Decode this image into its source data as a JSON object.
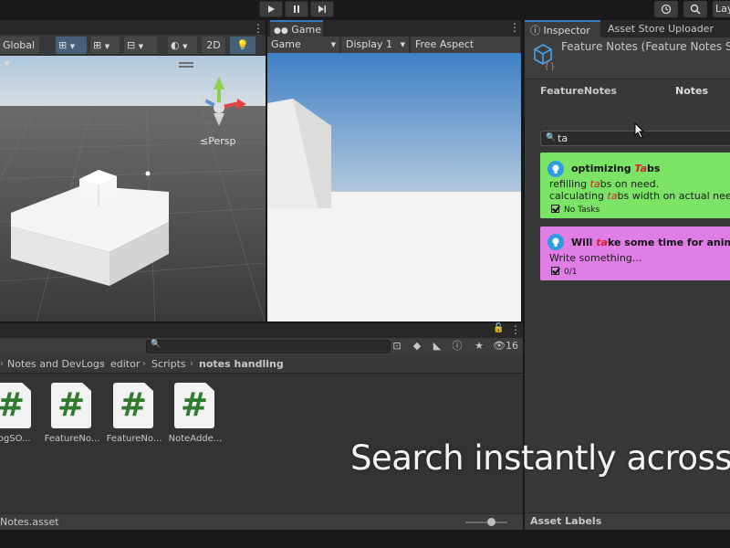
{
  "toolbar": {
    "play_icon": "▶",
    "pause_icon": "❚❚",
    "step_icon": "▶|",
    "history_icon": "history-icon",
    "search_icon": "search-icon",
    "layout_label": "Lay"
  },
  "scene": {
    "pivot_label": "Global",
    "mode_2d_label": "2D",
    "persp_label": "Persp"
  },
  "game": {
    "tab_label": "Game",
    "view_select": "Game",
    "display_select": "Display 1",
    "aspect_select": "Free Aspect"
  },
  "project": {
    "hidden_count": "16",
    "breadcrumbs": [
      "Notes and DevLogs",
      "editor",
      "Scripts",
      "notes handling"
    ],
    "files": [
      {
        "icon": "#",
        "name": "LogSO..."
      },
      {
        "icon": "#",
        "name": "FeatureNo..."
      },
      {
        "icon": "#",
        "name": "FeatureNo..."
      },
      {
        "icon": "#",
        "name": "NoteAdde..."
      }
    ],
    "status_label": "Notes.asset"
  },
  "inspector": {
    "tabs": [
      "Inspector",
      "Asset Store Uploader"
    ],
    "title": "Feature Notes (Feature Notes SO)",
    "field_name": "FeatureNotes",
    "field_value": "Notes",
    "search_value": "ta",
    "notes": [
      {
        "color": "#7be366",
        "title_pre": "optimizing ",
        "title_hl": "Ta",
        "title_post": "bs",
        "line1_pre": "refilling ",
        "line1_hl": "ta",
        "line1_post": "bs on need.",
        "line2_pre": " calculating ",
        "line2_hl": "ta",
        "line2_post": "bs width on actual need.",
        "tasks": "No Tasks"
      },
      {
        "color": "#e07ee6",
        "title_pre": "Will ",
        "title_hl": "ta",
        "title_post": "ke some time for animations",
        "line1": "Write something...",
        "tasks": "0/1"
      }
    ],
    "asset_labels": "Asset Labels"
  },
  "caption": "Search instantly across n"
}
